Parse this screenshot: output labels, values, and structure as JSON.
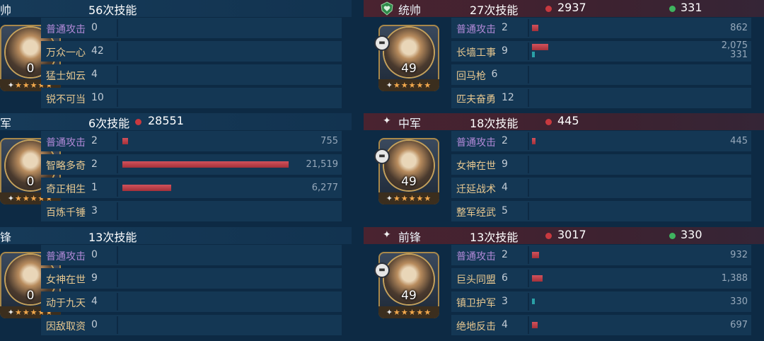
{
  "left": [
    {
      "role": "帅",
      "skill_count": "56次技能",
      "hero_level": "0",
      "rows": [
        {
          "name": "普通攻击",
          "normal": true,
          "times": "0"
        },
        {
          "name": "万众一心",
          "times": "42"
        },
        {
          "name": "猛士如云",
          "times": "4"
        },
        {
          "name": "锐不可当",
          "times": "10"
        }
      ]
    },
    {
      "role": "军",
      "skill_count": "6次技能",
      "damage": "28551",
      "hero_level": "0",
      "rows": [
        {
          "name": "普通攻击",
          "normal": true,
          "times": "2",
          "damage": 755,
          "damage_label": "755"
        },
        {
          "name": "智略多奇",
          "times": "2",
          "damage": 21519,
          "damage_label": "21,519"
        },
        {
          "name": "奇正相生",
          "times": "1",
          "damage": 6277,
          "damage_label": "6,277"
        },
        {
          "name": "百炼千锤",
          "times": "3"
        }
      ]
    },
    {
      "role": "锋",
      "skill_count": "13次技能",
      "hero_level": "0",
      "rows": [
        {
          "name": "普通攻击",
          "normal": true,
          "times": "0"
        },
        {
          "name": "女神在世",
          "times": "9"
        },
        {
          "name": "动于九天",
          "times": "4"
        },
        {
          "name": "因敌取资",
          "times": "0"
        }
      ]
    }
  ],
  "right": [
    {
      "role": "统帅",
      "role_icon": "heart-shield-icon",
      "skill_count": "27次技能",
      "damage": "2937",
      "heal": "331",
      "hero_level": "49",
      "unit_icon": "tank-icon",
      "rows": [
        {
          "name": "普通攻击",
          "normal": true,
          "times": "2",
          "damage": 862,
          "damage_label": "862"
        },
        {
          "name": "长墙工事",
          "times": "9",
          "damage": 2075,
          "damage_label": "2,075",
          "heal": 331,
          "heal_label": "331"
        },
        {
          "name": "回马枪",
          "times": "6"
        },
        {
          "name": "匹夫奋勇",
          "times": "12"
        }
      ]
    },
    {
      "role": "中军",
      "role_icon": "star-icon",
      "skill_count": "18次技能",
      "damage": "445",
      "hero_level": "49",
      "unit_icon": "tank-icon",
      "rows": [
        {
          "name": "普通攻击",
          "normal": true,
          "times": "2",
          "damage": 445,
          "damage_label": "445"
        },
        {
          "name": "女神在世",
          "times": "9"
        },
        {
          "name": "迁延战术",
          "times": "4"
        },
        {
          "name": "整军经武",
          "times": "5"
        }
      ]
    },
    {
      "role": "前锋",
      "role_icon": "star-icon",
      "skill_count": "13次技能",
      "damage": "3017",
      "heal": "330",
      "hero_level": "49",
      "unit_icon": "tank-icon",
      "rows": [
        {
          "name": "普通攻击",
          "normal": true,
          "times": "2",
          "damage": 932,
          "damage_label": "932"
        },
        {
          "name": "巨头同盟",
          "times": "6",
          "damage": 1388,
          "damage_label": "1,388"
        },
        {
          "name": "镇卫护军",
          "times": "3",
          "heal": 330,
          "heal_label": "330"
        },
        {
          "name": "绝地反击",
          "times": "4",
          "damage": 697,
          "damage_label": "697"
        }
      ]
    }
  ],
  "scale_max": 21519,
  "colors": {
    "damage": "#c8393f",
    "heal": "#3fb35f",
    "normal_attack": "#b28ad8",
    "skill": "#e8c890"
  }
}
